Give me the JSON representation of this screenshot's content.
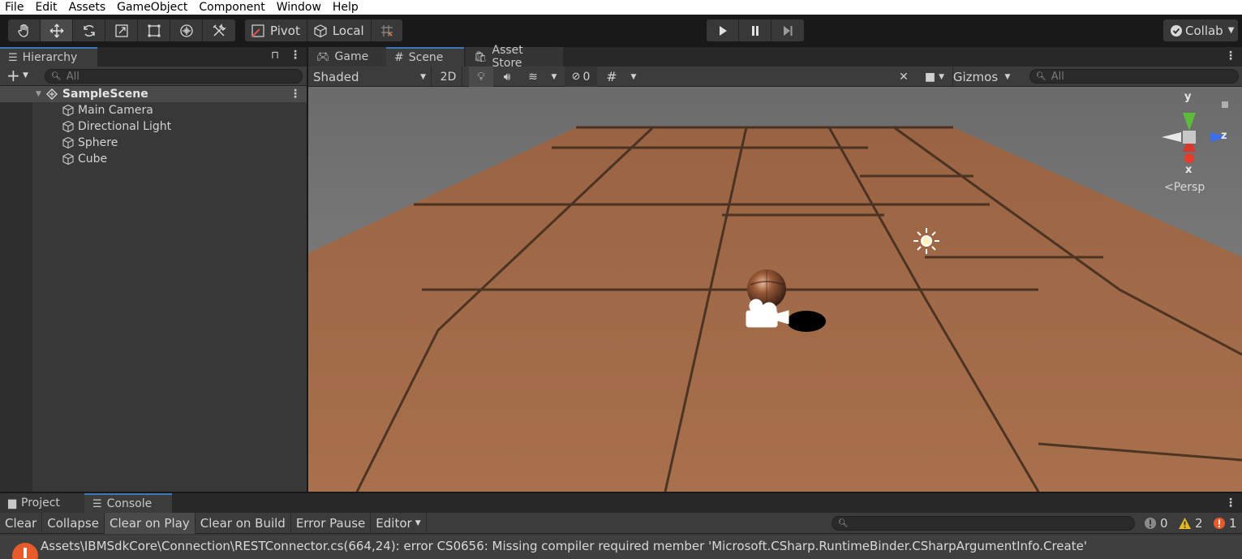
{
  "menu": [
    "File",
    "Edit",
    "Assets",
    "GameObject",
    "Component",
    "Window",
    "Help"
  ],
  "toolbar": {
    "pivot_label": "Pivot",
    "local_label": "Local",
    "collab_label": "Collab"
  },
  "hierarchy": {
    "tab_label": "Hierarchy",
    "add_label": "+",
    "search_placeholder": "All",
    "scene_name": "SampleScene",
    "objects": [
      "Main Camera",
      "Directional Light",
      "Sphere",
      "Cube"
    ]
  },
  "scene": {
    "tabs": {
      "game": "Game",
      "scene": "Scene",
      "asset_store": "Asset Store"
    },
    "shading_mode": "Shaded",
    "mode_2d": "2D",
    "hidden_count": "0",
    "gizmos_label": "Gizmos",
    "search_placeholder": "All",
    "gizmo": {
      "y": "y",
      "z": "z",
      "x": "x",
      "projection": "Persp"
    }
  },
  "console": {
    "tabs": {
      "project": "Project",
      "console": "Console"
    },
    "buttons": {
      "clear": "Clear",
      "collapse": "Collapse",
      "clear_on_play": "Clear on Play",
      "clear_on_build": "Clear on Build",
      "error_pause": "Error Pause",
      "editor": "Editor"
    },
    "counts": {
      "info": "0",
      "warning": "2",
      "error": "1"
    },
    "message": "Assets\\IBMSdkCore\\Connection\\RESTConnector.cs(664,24): error CS0656: Missing compiler required member 'Microsoft.CSharp.RuntimeBinder.CSharpArgumentInfo.Create'"
  },
  "colors": {
    "accent": "#3a79bb",
    "error": "#e85a2a",
    "warning": "#e8b923",
    "floor": "#a86a46"
  }
}
